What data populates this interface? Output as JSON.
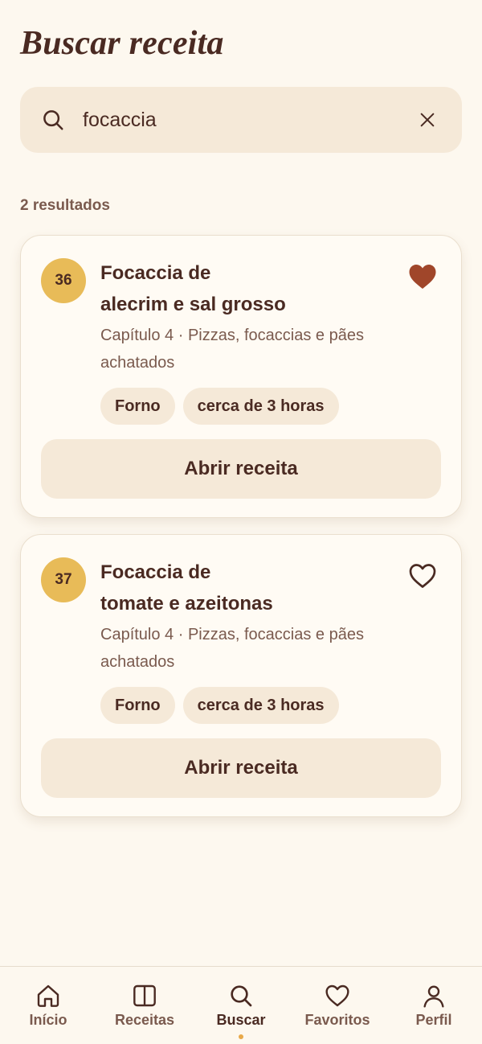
{
  "header": {
    "title": "Buscar receita"
  },
  "search": {
    "value": "focaccia",
    "placeholder": ""
  },
  "results": {
    "count_label": "2 resultados",
    "items": [
      {
        "number": "36",
        "title_line1": "Focaccia de",
        "title_line2": "alecrim e sal grosso",
        "subtitle": "Capítulo 4 · Pizzas, focaccias e pães achatados",
        "tags": [
          "Forno",
          "cerca de 3 horas"
        ],
        "favorite": true,
        "button_label": "Abrir receita"
      },
      {
        "number": "37",
        "title_line1": "Focaccia de",
        "title_line2": "tomate e azeitonas",
        "subtitle": "Capítulo 4 · Pizzas, focaccias e pães achatados",
        "tags": [
          "Forno",
          "cerca de 3 horas"
        ],
        "favorite": false,
        "button_label": "Abrir receita"
      }
    ]
  },
  "nav": {
    "items": [
      {
        "label": "Início",
        "icon": "home-icon"
      },
      {
        "label": "Receitas",
        "icon": "book-icon"
      },
      {
        "label": "Buscar",
        "icon": "search-icon"
      },
      {
        "label": "Favoritos",
        "icon": "heart-icon"
      },
      {
        "label": "Perfil",
        "icon": "user-icon"
      }
    ],
    "active": "Buscar"
  },
  "colors": {
    "background": "#fdf8ef",
    "text": "#4a2a22",
    "muted": "#7a5a4e",
    "badge": "#e8bb58",
    "favorite": "#a0462a",
    "chip": "#f5e9d8",
    "active_dot": "#e8a94a"
  }
}
